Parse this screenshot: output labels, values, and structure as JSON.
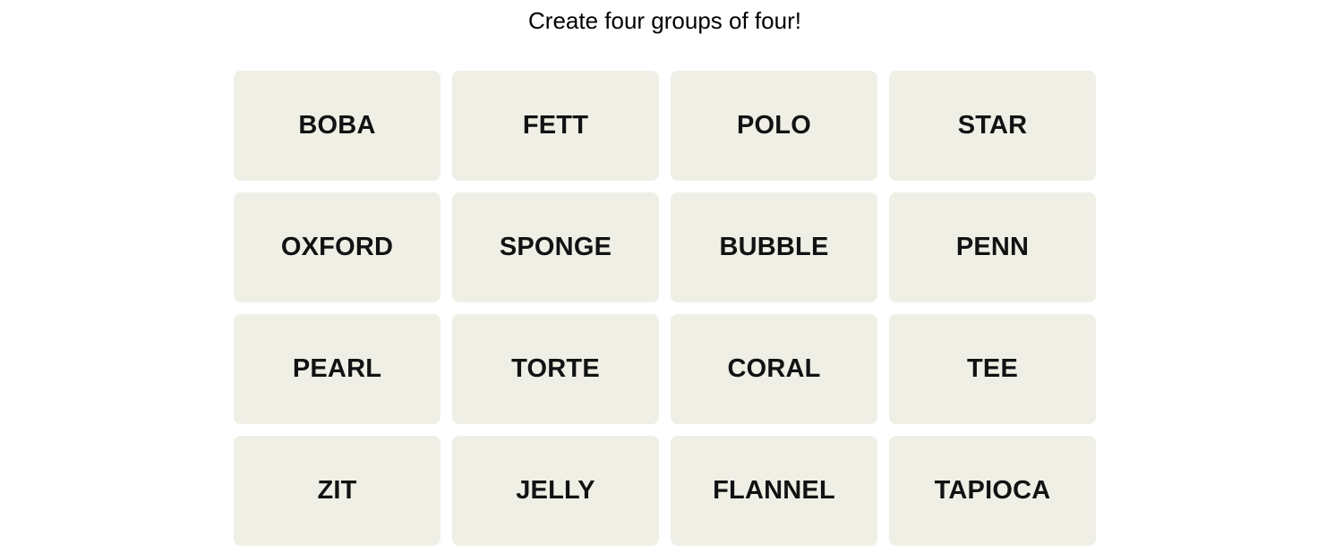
{
  "header": {
    "instruction": "Create four groups of four!"
  },
  "board": {
    "tiles": [
      {
        "label": "BOBA"
      },
      {
        "label": "FETT"
      },
      {
        "label": "POLO"
      },
      {
        "label": "STAR"
      },
      {
        "label": "OXFORD"
      },
      {
        "label": "SPONGE"
      },
      {
        "label": "BUBBLE"
      },
      {
        "label": "PENN"
      },
      {
        "label": "PEARL"
      },
      {
        "label": "TORTE"
      },
      {
        "label": "CORAL"
      },
      {
        "label": "TEE"
      },
      {
        "label": "ZIT"
      },
      {
        "label": "JELLY"
      },
      {
        "label": "FLANNEL"
      },
      {
        "label": "TAPIOCA"
      }
    ]
  },
  "colors": {
    "tile_bg": "#efefe6",
    "tile_text": "#121212"
  }
}
